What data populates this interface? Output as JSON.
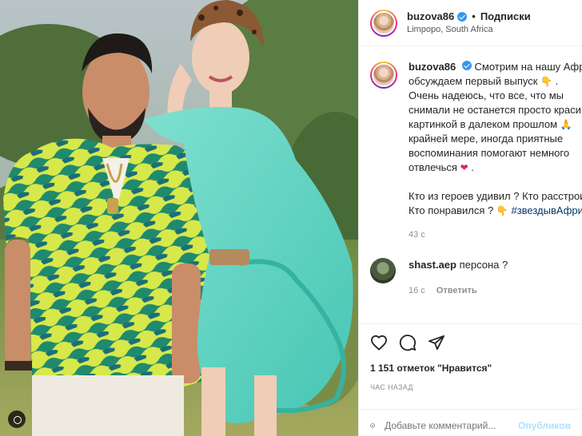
{
  "header": {
    "username": "buzova86",
    "separator": "•",
    "follow_label": "Подписки",
    "location": "Limpopo, South Africa"
  },
  "caption": {
    "username": "buzova86",
    "lines": [
      "Смотрим на нашу Афри",
      "обсуждаем первый выпуск",
      "Очень надеюсь, что все, что мы",
      "снимали не останется просто краси",
      "картинкой в далеком прошлом",
      "крайней мере, иногда приятные",
      "воспоминания помогают немного",
      "отвлечься",
      "Кто из героев удивил ? Кто расстрои",
      "Кто понравился ?"
    ],
    "hashtag": "#звездывАфри",
    "time": "43 с",
    "emoji": {
      "hand": "👇",
      "pray": "🙏",
      "heart": "❤"
    },
    "dot": "."
  },
  "comment": {
    "username": "shast.aep",
    "text": "персона ?",
    "time": "16 с",
    "reply_label": "Ответить"
  },
  "actions": {
    "likes": "1 151 отметок \"Нравится\"",
    "post_time": "ЧАС НАЗАД",
    "icons": [
      "heart-icon",
      "comment-icon",
      "share-icon"
    ]
  },
  "add_comment": {
    "placeholder": "Добавьте комментарий...",
    "publish_label": "Опубликов"
  },
  "colors": {
    "verified": "#3897f0",
    "hashtag": "#00376b",
    "muted": "#8e8e8e",
    "publish_disabled": "#b2dffc"
  }
}
